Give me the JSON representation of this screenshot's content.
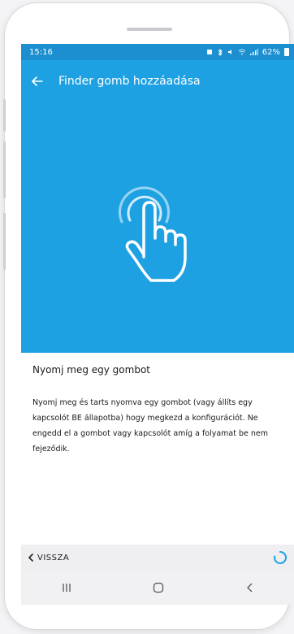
{
  "status_bar": {
    "time": "15:16",
    "battery": "62%"
  },
  "app_bar": {
    "title": "Finder gomb hozzáadása",
    "back_icon": "arrow-left-icon"
  },
  "hero": {
    "icon": "hand-press-icon",
    "background_color": "#1ea1e2"
  },
  "content": {
    "heading": "Nyomj meg egy gombot",
    "body": "Nyomj meg és tarts nyomva egy gombot (vagy állíts egy kapcsolót BE állapotba) hogy megkezd a konfigurációt. Ne engedd el a gombot vagy kapcsolót amíg a folyamat be nem fejeződik."
  },
  "footer": {
    "back_label": "VISSZA",
    "spinner_icon": "loading-spinner-icon",
    "accent_color": "#1ea1e2"
  },
  "nav_bar": {
    "recents_icon": "recent-apps-icon",
    "home_icon": "home-icon",
    "back_icon": "back-chevron-icon"
  }
}
